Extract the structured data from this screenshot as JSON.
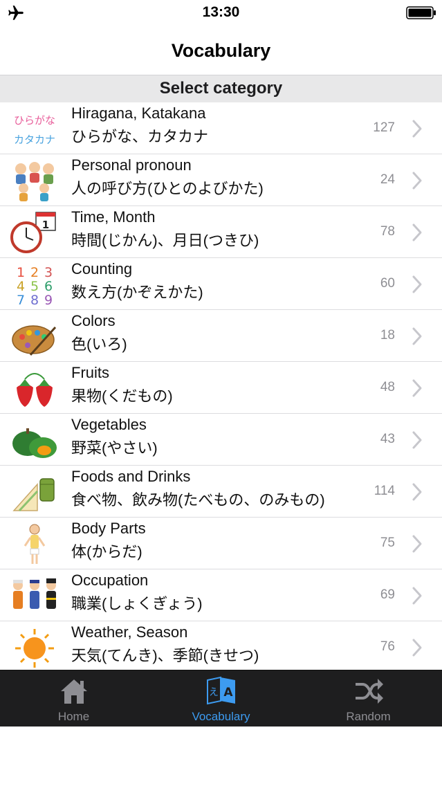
{
  "status_bar": {
    "time": "13:30"
  },
  "nav": {
    "title": "Vocabulary"
  },
  "section": {
    "header": "Select category"
  },
  "categories": [
    {
      "en": "Hiragana, Katakana",
      "jp": "ひらがな、カタカナ",
      "count": "127",
      "icon": "kana-icon"
    },
    {
      "en": "Personal pronoun",
      "jp": "人の呼び方(ひとのよびかた)",
      "count": "24",
      "icon": "people-icon"
    },
    {
      "en": "Time, Month",
      "jp": "時間(じかん)、月日(つきひ)",
      "count": "78",
      "icon": "clock-calendar-icon"
    },
    {
      "en": "Counting",
      "jp": "数え方(かぞえかた)",
      "count": "60",
      "icon": "numbers-icon"
    },
    {
      "en": "Colors",
      "jp": "色(いろ)",
      "count": "18",
      "icon": "palette-icon"
    },
    {
      "en": "Fruits",
      "jp": "果物(くだもの)",
      "count": "48",
      "icon": "strawberry-icon"
    },
    {
      "en": "Vegetables",
      "jp": "野菜(やさい)",
      "count": "43",
      "icon": "pumpkin-icon"
    },
    {
      "en": "Foods and Drinks",
      "jp": "食べ物、飲み物(たべもの、のみもの)",
      "count": "114",
      "icon": "sandwich-can-icon"
    },
    {
      "en": "Body Parts",
      "jp": "体(からだ)",
      "count": "75",
      "icon": "person-body-icon"
    },
    {
      "en": "Occupation",
      "jp": "職業(しょくぎょう)",
      "count": "69",
      "icon": "workers-icon"
    },
    {
      "en": "Weather, Season",
      "jp": "天気(てんき)、季節(きせつ)",
      "count": "76",
      "icon": "sun-icon"
    }
  ],
  "kana_icon_text": {
    "top": "ひらがな",
    "bottom": "カタカナ"
  },
  "numbers_icon_text": [
    "1",
    "2",
    "3",
    "4",
    "5",
    "6",
    "7",
    "8",
    "9"
  ],
  "tabs": [
    {
      "label": "Home",
      "icon": "home-icon",
      "active": false
    },
    {
      "label": "Vocabulary",
      "icon": "translate-icon",
      "active": true
    },
    {
      "label": "Random",
      "icon": "shuffle-icon",
      "active": false
    }
  ],
  "colors": {
    "accent": "#3d9bf0",
    "tab_bar": "#1e1e1f",
    "section_bg": "#e8e8e9",
    "count": "#8e8e93"
  }
}
